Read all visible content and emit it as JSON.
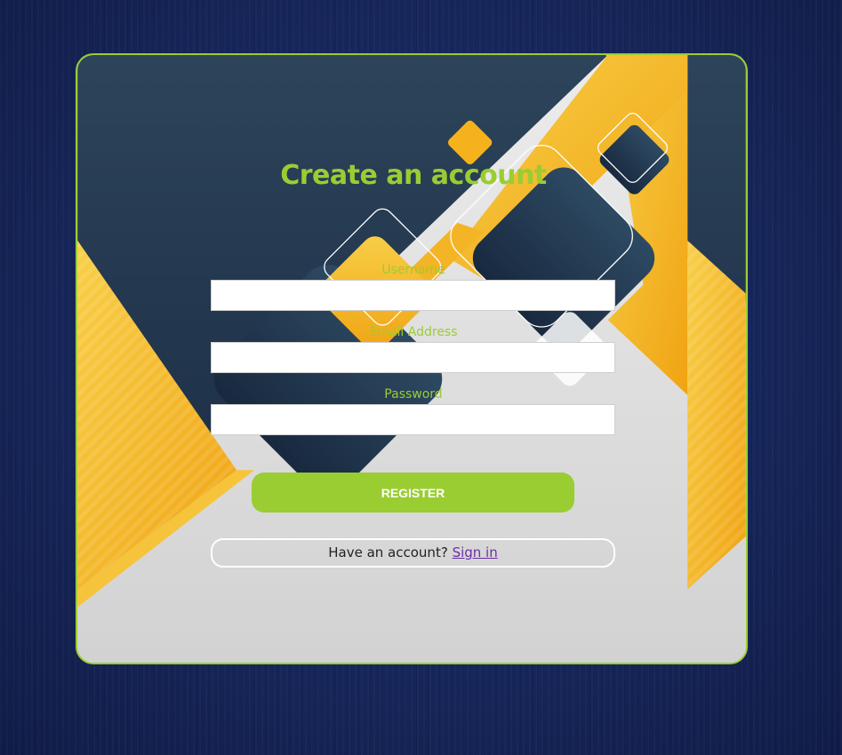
{
  "form": {
    "title": "Create an account",
    "fields": [
      {
        "label": "Username",
        "value": "",
        "placeholder": ""
      },
      {
        "label": "Email Address",
        "value": "",
        "placeholder": ""
      },
      {
        "label": "Password",
        "value": "",
        "placeholder": ""
      }
    ],
    "register_label": "REGISTER",
    "signin_prompt": "Have an account?",
    "signin_link": "Sign in"
  },
  "colors": {
    "accent": "#9acd32",
    "page_background": "#17275b",
    "art_navy": "#2c4258",
    "art_yellow": "#f5b21c",
    "art_light_gray": "#e2e2e2",
    "link": "#6a2fa8"
  }
}
